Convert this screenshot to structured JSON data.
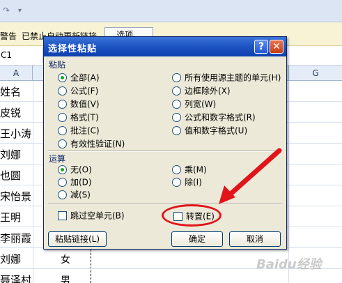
{
  "qat": {
    "redo_glyph": "↷",
    "separator": "▾"
  },
  "message_bar": {
    "warning": "警告",
    "disabled_text": "已禁止自动更新链接",
    "options_button": "选项..."
  },
  "formula_bar": {
    "name_box": "C1"
  },
  "columns": {
    "a": "A",
    "g": "G"
  },
  "sheet_rows": [
    {
      "name": "姓名",
      "gender": ""
    },
    {
      "name": "皮锐",
      "gender": ""
    },
    {
      "name": "王小涛",
      "gender": ""
    },
    {
      "name": "刘娜",
      "gender": ""
    },
    {
      "name": "也圆",
      "gender": ""
    },
    {
      "name": "宋怡景",
      "gender": ""
    },
    {
      "name": "王明",
      "gender": ""
    },
    {
      "name": "李丽霞",
      "gender": ""
    },
    {
      "name": "刘娜",
      "gender": "女"
    },
    {
      "name": "聂泽村",
      "gender": "男"
    }
  ],
  "dialog": {
    "title": "选择性粘贴",
    "help_button": "?",
    "close_button": "✕",
    "paste_section": "粘贴",
    "paste_left": [
      {
        "label": "全部(A)",
        "selected": true
      },
      {
        "label": "公式(F)",
        "selected": false
      },
      {
        "label": "数值(V)",
        "selected": false
      },
      {
        "label": "格式(T)",
        "selected": false
      },
      {
        "label": "批注(C)",
        "selected": false
      },
      {
        "label": "有效性验证(N)",
        "selected": false
      }
    ],
    "paste_right": [
      {
        "label": "所有使用源主题的单元(H)",
        "selected": false
      },
      {
        "label": "边框除外(X)",
        "selected": false
      },
      {
        "label": "列宽(W)",
        "selected": false
      },
      {
        "label": "公式和数字格式(R)",
        "selected": false
      },
      {
        "label": "值和数字格式(U)",
        "selected": false
      }
    ],
    "operation_section": "运算",
    "operation_left": [
      {
        "label": "无(O)",
        "selected": true
      },
      {
        "label": "加(D)",
        "selected": false
      },
      {
        "label": "减(S)",
        "selected": false
      }
    ],
    "operation_right": [
      {
        "label": "乘(M)",
        "selected": false
      },
      {
        "label": "除(I)",
        "selected": false
      }
    ],
    "skip_blanks": {
      "label": "跳过空单元(B)",
      "checked": false
    },
    "transpose": {
      "label": "转置(E)",
      "checked": false
    },
    "paste_link_button": "粘贴链接(L)",
    "ok_button": "确定",
    "cancel_button": "取消"
  },
  "annotation": {
    "color": "#e0141a"
  },
  "watermark": "Baidu经验"
}
